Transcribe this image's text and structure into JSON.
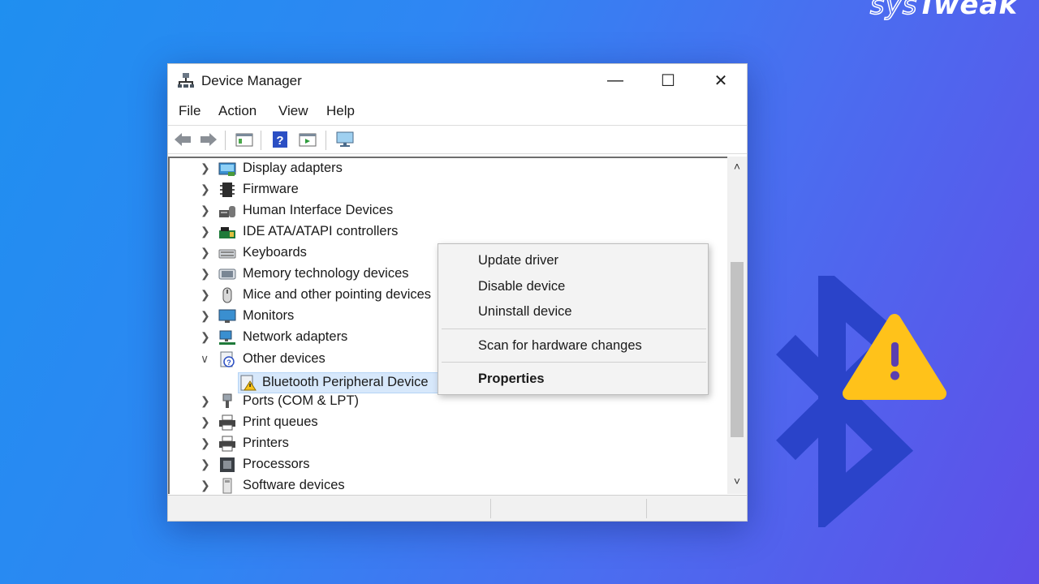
{
  "brand": {
    "prefix": "sys",
    "name": "Tweak"
  },
  "window": {
    "title": "Device Manager",
    "controls": {
      "minimize": "—",
      "maximize": "☐",
      "close": "✕"
    }
  },
  "menu": [
    "File",
    "Action",
    "View",
    "Help"
  ],
  "tree": {
    "items": [
      {
        "label": "Display adapters",
        "icon": "display-adapter-icon",
        "expanded": false
      },
      {
        "label": "Firmware",
        "icon": "firmware-icon",
        "expanded": false
      },
      {
        "label": "Human Interface Devices",
        "icon": "hid-icon",
        "expanded": false
      },
      {
        "label": "IDE ATA/ATAPI controllers",
        "icon": "ide-controller-icon",
        "expanded": false
      },
      {
        "label": "Keyboards",
        "icon": "keyboard-icon",
        "expanded": false
      },
      {
        "label": "Memory technology devices",
        "icon": "memory-icon",
        "expanded": false
      },
      {
        "label": "Mice and other pointing devices",
        "icon": "mouse-icon",
        "expanded": false
      },
      {
        "label": "Monitors",
        "icon": "monitor-icon",
        "expanded": false
      },
      {
        "label": "Network adapters",
        "icon": "network-adapter-icon",
        "expanded": false
      },
      {
        "label": "Other devices",
        "icon": "other-devices-icon",
        "expanded": true
      },
      {
        "label": "Bluetooth Peripheral Device",
        "icon": "warning-device-icon",
        "child": true
      },
      {
        "label": "Ports (COM & LPT)",
        "icon": "port-icon",
        "expanded": false
      },
      {
        "label": "Print queues",
        "icon": "print-queue-icon",
        "expanded": false
      },
      {
        "label": "Printers",
        "icon": "printer-icon",
        "expanded": false
      },
      {
        "label": "Processors",
        "icon": "processor-icon",
        "expanded": false
      },
      {
        "label": "Software devices",
        "icon": "software-device-icon",
        "expanded": false
      }
    ]
  },
  "context_menu": {
    "update": "Update driver",
    "disable": "Disable device",
    "uninstall": "Uninstall device",
    "scan": "Scan for hardware changes",
    "properties": "Properties"
  },
  "colors": {
    "bluetooth": "#2a43c9",
    "warning": "#ffc21a",
    "selection": "#d7e8fb"
  }
}
